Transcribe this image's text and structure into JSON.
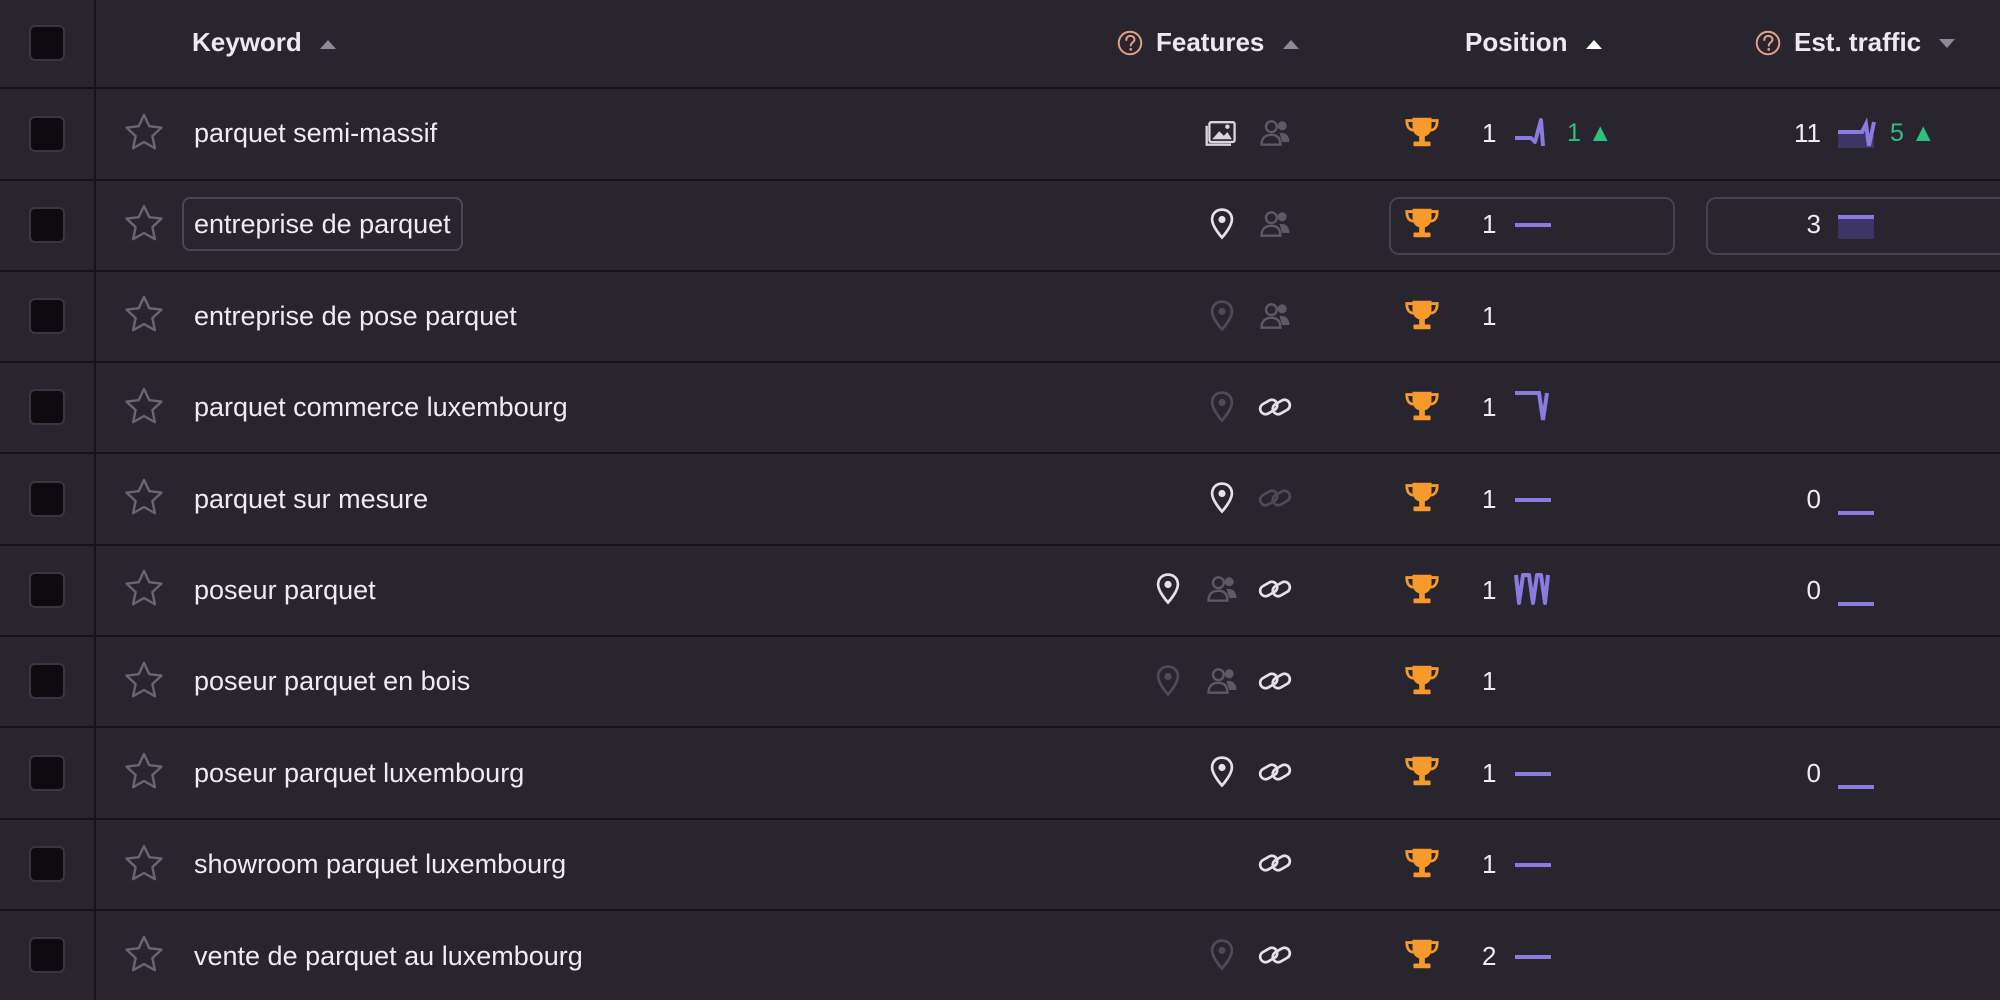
{
  "header": {
    "keyword": "Keyword",
    "features": "Features",
    "position": "Position",
    "traffic": "Est. traffic"
  },
  "colors": {
    "background": "#28252f",
    "trophy": "#f59a2b",
    "sparkline": "#8b7ae0",
    "positive": "#2fbf7f",
    "help_icon": "#e4a08a"
  },
  "rows": [
    {
      "keyword": "parquet semi-massif",
      "features": [
        "image-pack-icon",
        "people-also-ask-icon-dim"
      ],
      "position": "1",
      "position_change": "1",
      "traffic": "11",
      "traffic_change": "5"
    },
    {
      "keyword": "entreprise de parquet",
      "features": [
        "location-pin-icon",
        "people-also-ask-icon-dim"
      ],
      "position": "1",
      "traffic": "3"
    },
    {
      "keyword": "entreprise de pose parquet",
      "features": [
        "location-pin-icon-dim",
        "people-also-ask-icon-dim"
      ],
      "position": "1",
      "traffic": ""
    },
    {
      "keyword": "parquet commerce luxembourg",
      "features": [
        "location-pin-icon-dim",
        "sitelinks-icon"
      ],
      "position": "1",
      "traffic": ""
    },
    {
      "keyword": "parquet sur mesure",
      "features": [
        "location-pin-icon",
        "sitelinks-icon-dim"
      ],
      "position": "1",
      "traffic": "0"
    },
    {
      "keyword": "poseur parquet",
      "features": [
        "location-pin-icon",
        "people-also-ask-icon-dim",
        "sitelinks-icon"
      ],
      "position": "1",
      "traffic": "0"
    },
    {
      "keyword": "poseur parquet en bois",
      "features": [
        "location-pin-icon-dim",
        "people-also-ask-icon-dim",
        "sitelinks-icon"
      ],
      "position": "1",
      "traffic": ""
    },
    {
      "keyword": "poseur parquet luxembourg",
      "features": [
        "location-pin-icon",
        "sitelinks-icon"
      ],
      "position": "1",
      "traffic": "0"
    },
    {
      "keyword": "showroom parquet luxembourg",
      "features": [
        "sitelinks-icon"
      ],
      "position": "1",
      "traffic": ""
    },
    {
      "keyword": "vente de parquet au luxembourg",
      "features": [
        "location-pin-icon-dim",
        "sitelinks-icon"
      ],
      "position": "2",
      "traffic": ""
    }
  ]
}
